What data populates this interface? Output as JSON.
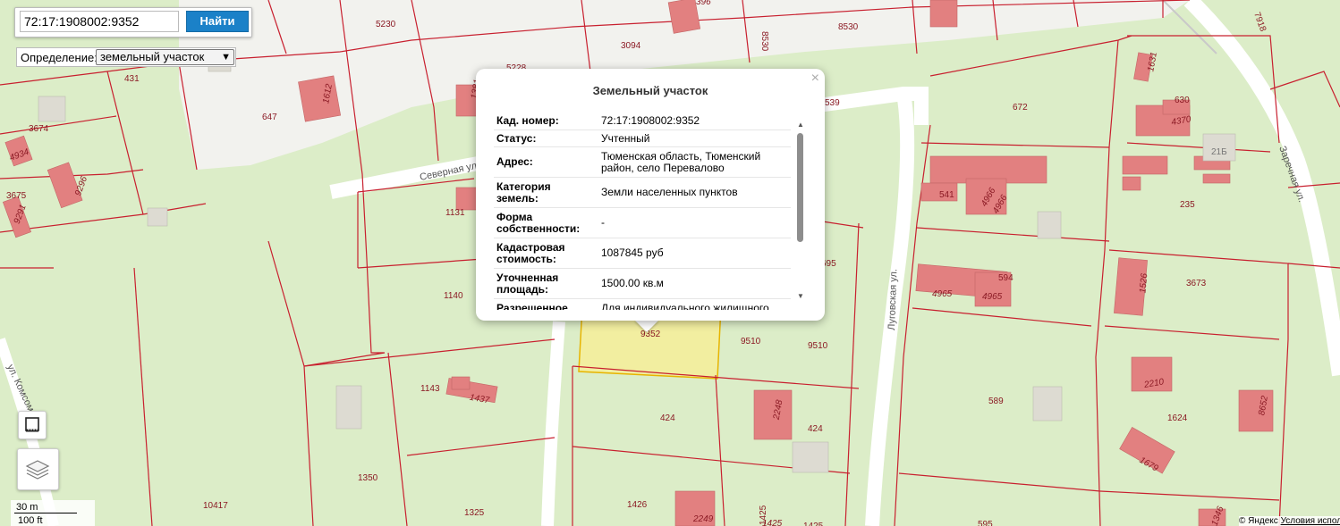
{
  "search": {
    "value": "72:17:1908002:9352",
    "button_label": "Найти"
  },
  "definition": {
    "label": "Определение:",
    "selected": "земельный участок"
  },
  "scale": {
    "metric": "30 m",
    "imperial": "100 ft"
  },
  "copyright": {
    "text": "© Яндекс",
    "terms_link": "Условия использования"
  },
  "popup": {
    "title": "Земельный участок",
    "close_label": "×",
    "rows": [
      {
        "key": "Кад. номер:",
        "value": "72:17:1908002:9352"
      },
      {
        "key": "Статус:",
        "value": "Учтенный"
      },
      {
        "key": "Адрес:",
        "value": "Тюменская область, Тюменский район, село Перевалово"
      },
      {
        "key": "Категория земель:",
        "value": "Земли населенных пунктов"
      },
      {
        "key": "Форма собственности:",
        "value": "-"
      },
      {
        "key": "Кадастровая стоимость:",
        "value": "1087845 руб"
      },
      {
        "key": "Уточненная площадь:",
        "value": "1500.00 кв.м"
      },
      {
        "key": "Разрешенное",
        "value": "Для индивидуального жилищного"
      }
    ]
  },
  "map": {
    "street_labels": {
      "severnaya": "Северная ул.",
      "lugovaya": "Луговская ул.",
      "zarechnaya": "Заречная ул.",
      "left_edge": "ул. Комсомол",
      "top_right": "7918"
    },
    "parcel_labels": [
      "5230",
      "3094",
      "8530",
      "8530",
      "431",
      "647",
      "3674",
      "3675",
      "1131",
      "1140",
      "1143",
      "1350",
      "10417",
      "1325",
      "1426",
      "1425",
      "1425",
      "424",
      "424",
      "9510",
      "9510",
      "9352",
      "672",
      "630",
      "235",
      "594",
      "3673",
      "589",
      "1624",
      "595",
      "21Б",
      "541",
      "539",
      "695",
      "5228"
    ],
    "building_labels": [
      "396",
      "1612",
      "1631",
      "4370",
      "4934",
      "9296",
      "9291",
      "1437",
      "2248",
      "2249",
      "4966",
      "4966",
      "4965",
      "4965",
      "1526",
      "2210",
      "8652",
      "1679",
      "1346",
      "1381",
      "1425"
    ]
  }
}
